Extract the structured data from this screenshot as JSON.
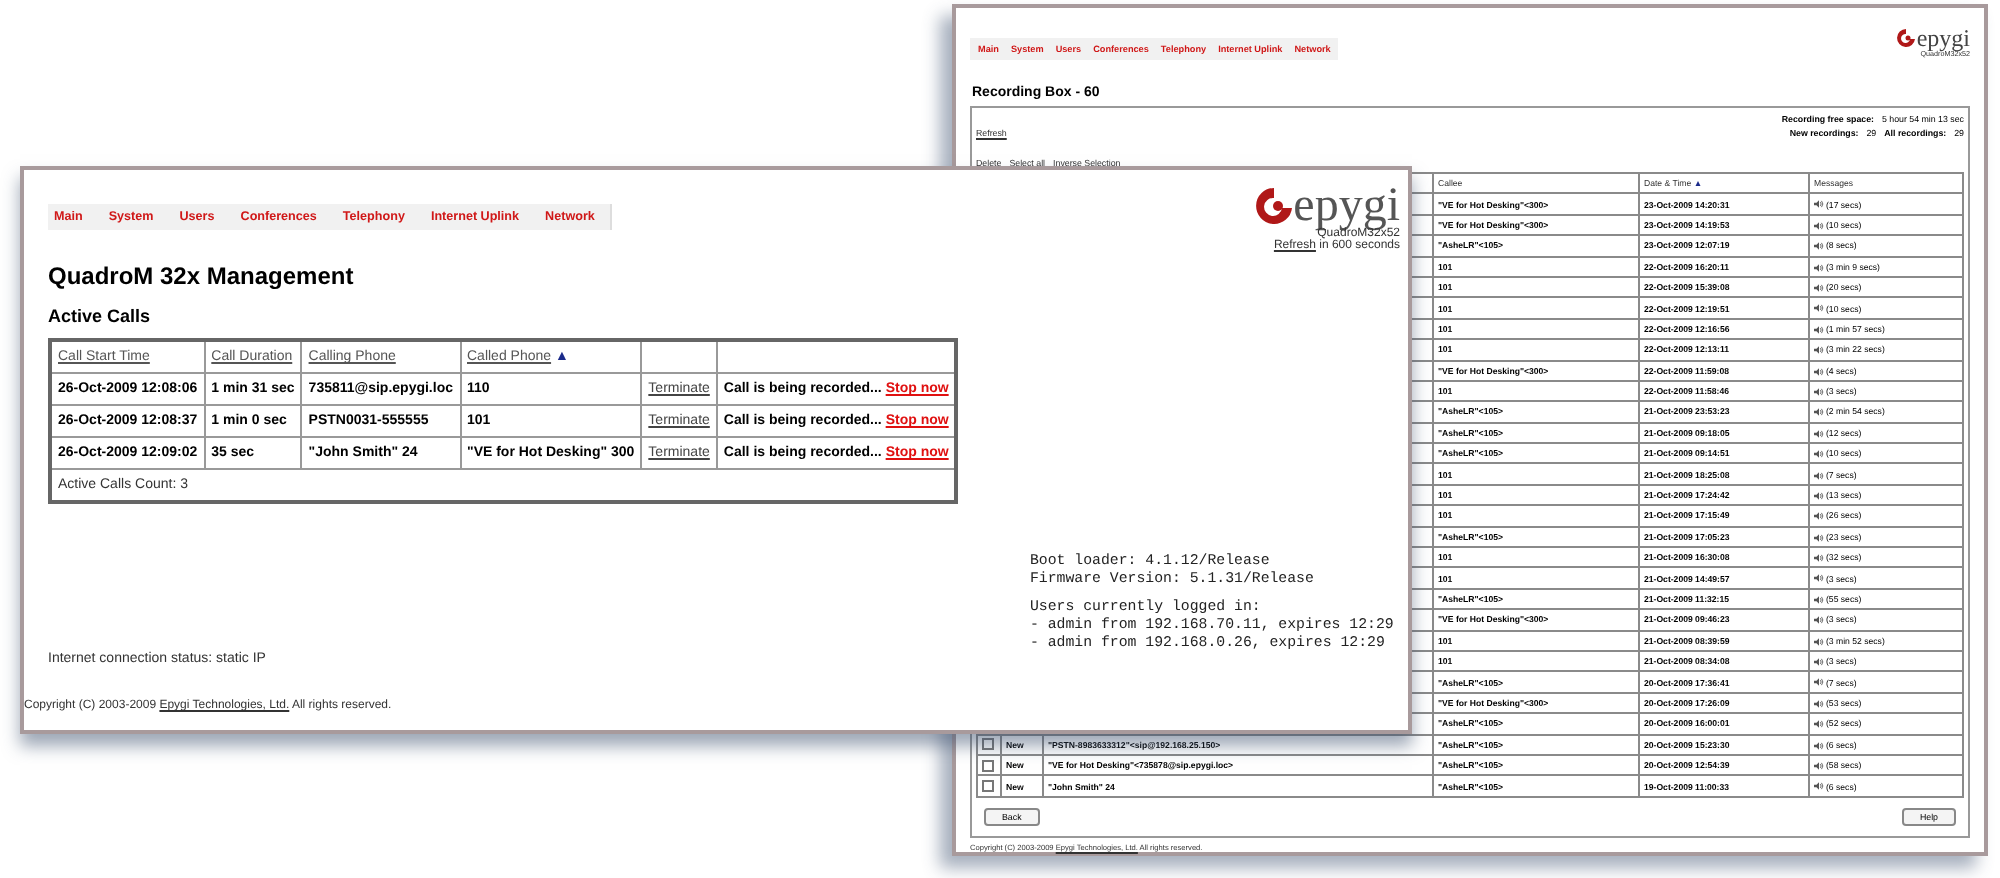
{
  "recording_window": {
    "nav_tabs": [
      "Main",
      "System",
      "Users",
      "Conferences",
      "Telephony",
      "Internet Uplink",
      "Network"
    ],
    "logo": {
      "brand": "epygi",
      "model": "QuadroM32x52"
    },
    "title": "Recording Box - 60",
    "free_space": {
      "label": "Recording free space:",
      "value": "5 hour 54 min 13 sec"
    },
    "refresh_link": "Refresh",
    "counts": [
      {
        "label": "New recordings:",
        "value": "29"
      },
      {
        "label": "All recordings:",
        "value": "29"
      }
    ],
    "actions": [
      "Delete",
      "Select all",
      "Inverse Selection"
    ],
    "table": {
      "columns": [
        {
          "label": "Callee"
        },
        {
          "label": "Date & Time",
          "sort_indicator": "▲"
        },
        {
          "label": "Messages"
        }
      ],
      "rows": [
        {
          "callee": "\"VE for Hot Desking\"<300>",
          "date": "23-Oct-2009 14:20:31",
          "message": "(17 secs)"
        },
        {
          "callee": "\"VE for Hot Desking\"<300>",
          "date": "23-Oct-2009 14:19:53",
          "message": "(10 secs)"
        },
        {
          "callee": "\"AsheLR\"<105>",
          "date": "23-Oct-2009 12:07:19",
          "message": "(8 secs)"
        },
        {
          "callee": "101",
          "date": "22-Oct-2009 16:20:11",
          "message": "(3 min 9 secs)"
        },
        {
          "callee": "101",
          "date": "22-Oct-2009 15:39:08",
          "message": "(20 secs)"
        },
        {
          "callee": "101",
          "date": "22-Oct-2009 12:19:51",
          "message": "(10 secs)"
        },
        {
          "callee": "101",
          "date": "22-Oct-2009 12:16:56",
          "message": "(1 min 57 secs)"
        },
        {
          "callee": "101",
          "date": "22-Oct-2009 12:13:11",
          "message": "(3 min 22 secs)"
        },
        {
          "callee": "\"VE for Hot Desking\"<300>",
          "date": "22-Oct-2009 11:59:08",
          "message": "(4 secs)"
        },
        {
          "callee": "101",
          "date": "22-Oct-2009 11:58:46",
          "message": "(3 secs)"
        },
        {
          "callee": "\"AsheLR\"<105>",
          "date": "21-Oct-2009 23:53:23",
          "message": "(2 min 54 secs)"
        },
        {
          "callee": "\"AsheLR\"<105>",
          "date": "21-Oct-2009 09:18:05",
          "message": "(12 secs)"
        },
        {
          "callee": "\"AsheLR\"<105>",
          "date": "21-Oct-2009 09:14:51",
          "message": "(10 secs)"
        },
        {
          "callee": "101",
          "date": "21-Oct-2009 18:25:08",
          "message": "(7 secs)"
        },
        {
          "callee": "101",
          "date": "21-Oct-2009 17:24:42",
          "message": "(13 secs)"
        },
        {
          "callee": "101",
          "date": "21-Oct-2009 17:15:49",
          "message": "(26 secs)"
        },
        {
          "callee": "\"AsheLR\"<105>",
          "date": "21-Oct-2009 17:05:23",
          "message": "(23 secs)"
        },
        {
          "callee": "101",
          "date": "21-Oct-2009 16:30:08",
          "message": "(32 secs)"
        },
        {
          "callee": "101",
          "date": "21-Oct-2009 14:49:57",
          "message": "(3 secs)"
        },
        {
          "callee": "\"AsheLR\"<105>",
          "date": "21-Oct-2009 11:32:15",
          "message": "(55 secs)"
        },
        {
          "callee": "\"VE for Hot Desking\"<300>",
          "date": "21-Oct-2009 09:46:23",
          "message": "(3 secs)"
        },
        {
          "callee": "101",
          "date": "21-Oct-2009 08:39:59",
          "message": "(3 min 52 secs)"
        },
        {
          "callee": "101",
          "date": "21-Oct-2009 08:34:08",
          "message": "(3 secs)"
        },
        {
          "callee": "\"AsheLR\"<105>",
          "date": "20-Oct-2009 17:36:41",
          "message": "(7 secs)"
        },
        {
          "callee": "\"VE for Hot Desking\"<300>",
          "date": "20-Oct-2009 17:26:09",
          "message": "(53 secs)"
        },
        {
          "callee": "\"AsheLR\"<105>",
          "date": "20-Oct-2009 16:00:01",
          "message": "(52 secs)"
        },
        {
          "checked": false,
          "status": "New",
          "caller": "\"PSTN-8983633312\"<sip@192.168.25.150>",
          "callee": "\"AsheLR\"<105>",
          "date": "20-Oct-2009 15:23:30",
          "message": "(6 secs)"
        },
        {
          "checked": false,
          "status": "New",
          "caller": "\"VE for Hot Desking\"<735878@sip.epygi.loc>",
          "callee": "\"AsheLR\"<105>",
          "date": "20-Oct-2009 12:54:39",
          "message": "(58 secs)"
        },
        {
          "checked": false,
          "status": "New",
          "caller": "\"John Smith\" 24",
          "callee": "\"AsheLR\"<105>",
          "date": "19-Oct-2009 11:00:33",
          "message": "(6 secs)"
        }
      ]
    },
    "buttons": [
      "Back",
      "Help"
    ],
    "copyright": {
      "text": "Copyright (C) 2003-2009",
      "link": "Epygi Technologies, Ltd.",
      "rest": "All rights reserved."
    }
  },
  "management_window": {
    "nav_tabs": [
      "Main",
      "System",
      "Users",
      "Conferences",
      "Telephony",
      "Internet Uplink",
      "Network"
    ],
    "logo": {
      "brand": "epygi",
      "model": "QuadroM32x52"
    },
    "refresh": {
      "link": "Refresh",
      "text": "in 600 seconds"
    },
    "title": "QuadroM 32x Management",
    "section": "Active Calls",
    "table": {
      "columns": [
        {
          "label": "Call Start Time"
        },
        {
          "label": "Call Duration"
        },
        {
          "label": "Calling Phone"
        },
        {
          "label": "Called Phone",
          "sort_indicator": "▲"
        }
      ],
      "rows": [
        {
          "start": "26-Oct-2009 12:08:06",
          "duration": "1 min 31 sec",
          "calling": "735811@sip.epygi.loc",
          "called": "110",
          "action": "Terminate",
          "status": "Call is being recorded...",
          "stop": "Stop now"
        },
        {
          "start": "26-Oct-2009 12:08:37",
          "duration": "1 min 0 sec",
          "calling": "PSTN0031-555555",
          "called": "101",
          "action": "Terminate",
          "status": "Call is being recorded...",
          "stop": "Stop now"
        },
        {
          "start": "26-Oct-2009 12:09:02",
          "duration": "35 sec",
          "calling": "\"John Smith\" 24",
          "called": "\"VE for Hot Desking\" 300",
          "action": "Terminate",
          "status": "Call is being recorded...",
          "stop": "Stop now"
        }
      ],
      "count": "Active Calls Count: 3"
    },
    "system_info": [
      [
        "Boot loader: 4.1.12/Release",
        "Firmware Version: 5.1.31/Release"
      ],
      [
        "Users currently logged in:",
        "- admin from 192.168.70.11, expires 12:29",
        "- admin from 192.168.0.26, expires 12:29"
      ]
    ],
    "connection_status": "Internet connection status: static IP",
    "copyright": {
      "text": "Copyright (C) 2003-2009",
      "link": "Epygi Technologies, Ltd.",
      "rest": "All rights reserved."
    }
  }
}
